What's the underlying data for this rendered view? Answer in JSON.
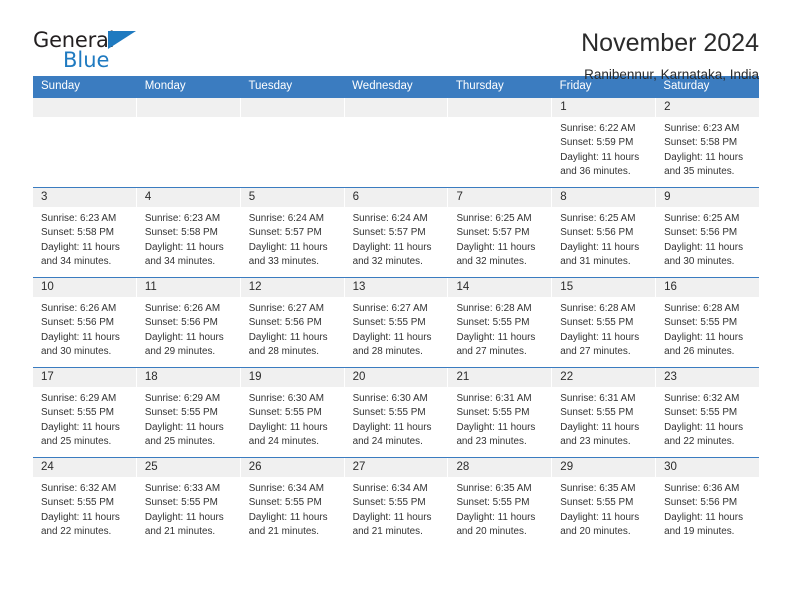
{
  "brand": {
    "name_part1": "General",
    "name_part2": "Blue",
    "triangle_color": "#1f7ac0"
  },
  "header": {
    "title": "November 2024",
    "subtitle": "Ranibennur, Karnataka, India"
  },
  "calendar": {
    "accent_color": "#3b7cc0",
    "daynum_bg": "#f0f0f0",
    "weekday_headers": [
      "Sunday",
      "Monday",
      "Tuesday",
      "Wednesday",
      "Thursday",
      "Friday",
      "Saturday"
    ],
    "weeks": [
      [
        {
          "day": "",
          "empty": true
        },
        {
          "day": "",
          "empty": true
        },
        {
          "day": "",
          "empty": true
        },
        {
          "day": "",
          "empty": true
        },
        {
          "day": "",
          "empty": true
        },
        {
          "day": "1",
          "sunrise": "Sunrise: 6:22 AM",
          "sunset": "Sunset: 5:59 PM",
          "daylight": "Daylight: 11 hours and 36 minutes."
        },
        {
          "day": "2",
          "sunrise": "Sunrise: 6:23 AM",
          "sunset": "Sunset: 5:58 PM",
          "daylight": "Daylight: 11 hours and 35 minutes."
        }
      ],
      [
        {
          "day": "3",
          "sunrise": "Sunrise: 6:23 AM",
          "sunset": "Sunset: 5:58 PM",
          "daylight": "Daylight: 11 hours and 34 minutes."
        },
        {
          "day": "4",
          "sunrise": "Sunrise: 6:23 AM",
          "sunset": "Sunset: 5:58 PM",
          "daylight": "Daylight: 11 hours and 34 minutes."
        },
        {
          "day": "5",
          "sunrise": "Sunrise: 6:24 AM",
          "sunset": "Sunset: 5:57 PM",
          "daylight": "Daylight: 11 hours and 33 minutes."
        },
        {
          "day": "6",
          "sunrise": "Sunrise: 6:24 AM",
          "sunset": "Sunset: 5:57 PM",
          "daylight": "Daylight: 11 hours and 32 minutes."
        },
        {
          "day": "7",
          "sunrise": "Sunrise: 6:25 AM",
          "sunset": "Sunset: 5:57 PM",
          "daylight": "Daylight: 11 hours and 32 minutes."
        },
        {
          "day": "8",
          "sunrise": "Sunrise: 6:25 AM",
          "sunset": "Sunset: 5:56 PM",
          "daylight": "Daylight: 11 hours and 31 minutes."
        },
        {
          "day": "9",
          "sunrise": "Sunrise: 6:25 AM",
          "sunset": "Sunset: 5:56 PM",
          "daylight": "Daylight: 11 hours and 30 minutes."
        }
      ],
      [
        {
          "day": "10",
          "sunrise": "Sunrise: 6:26 AM",
          "sunset": "Sunset: 5:56 PM",
          "daylight": "Daylight: 11 hours and 30 minutes."
        },
        {
          "day": "11",
          "sunrise": "Sunrise: 6:26 AM",
          "sunset": "Sunset: 5:56 PM",
          "daylight": "Daylight: 11 hours and 29 minutes."
        },
        {
          "day": "12",
          "sunrise": "Sunrise: 6:27 AM",
          "sunset": "Sunset: 5:56 PM",
          "daylight": "Daylight: 11 hours and 28 minutes."
        },
        {
          "day": "13",
          "sunrise": "Sunrise: 6:27 AM",
          "sunset": "Sunset: 5:55 PM",
          "daylight": "Daylight: 11 hours and 28 minutes."
        },
        {
          "day": "14",
          "sunrise": "Sunrise: 6:28 AM",
          "sunset": "Sunset: 5:55 PM",
          "daylight": "Daylight: 11 hours and 27 minutes."
        },
        {
          "day": "15",
          "sunrise": "Sunrise: 6:28 AM",
          "sunset": "Sunset: 5:55 PM",
          "daylight": "Daylight: 11 hours and 27 minutes."
        },
        {
          "day": "16",
          "sunrise": "Sunrise: 6:28 AM",
          "sunset": "Sunset: 5:55 PM",
          "daylight": "Daylight: 11 hours and 26 minutes."
        }
      ],
      [
        {
          "day": "17",
          "sunrise": "Sunrise: 6:29 AM",
          "sunset": "Sunset: 5:55 PM",
          "daylight": "Daylight: 11 hours and 25 minutes."
        },
        {
          "day": "18",
          "sunrise": "Sunrise: 6:29 AM",
          "sunset": "Sunset: 5:55 PM",
          "daylight": "Daylight: 11 hours and 25 minutes."
        },
        {
          "day": "19",
          "sunrise": "Sunrise: 6:30 AM",
          "sunset": "Sunset: 5:55 PM",
          "daylight": "Daylight: 11 hours and 24 minutes."
        },
        {
          "day": "20",
          "sunrise": "Sunrise: 6:30 AM",
          "sunset": "Sunset: 5:55 PM",
          "daylight": "Daylight: 11 hours and 24 minutes."
        },
        {
          "day": "21",
          "sunrise": "Sunrise: 6:31 AM",
          "sunset": "Sunset: 5:55 PM",
          "daylight": "Daylight: 11 hours and 23 minutes."
        },
        {
          "day": "22",
          "sunrise": "Sunrise: 6:31 AM",
          "sunset": "Sunset: 5:55 PM",
          "daylight": "Daylight: 11 hours and 23 minutes."
        },
        {
          "day": "23",
          "sunrise": "Sunrise: 6:32 AM",
          "sunset": "Sunset: 5:55 PM",
          "daylight": "Daylight: 11 hours and 22 minutes."
        }
      ],
      [
        {
          "day": "24",
          "sunrise": "Sunrise: 6:32 AM",
          "sunset": "Sunset: 5:55 PM",
          "daylight": "Daylight: 11 hours and 22 minutes."
        },
        {
          "day": "25",
          "sunrise": "Sunrise: 6:33 AM",
          "sunset": "Sunset: 5:55 PM",
          "daylight": "Daylight: 11 hours and 21 minutes."
        },
        {
          "day": "26",
          "sunrise": "Sunrise: 6:34 AM",
          "sunset": "Sunset: 5:55 PM",
          "daylight": "Daylight: 11 hours and 21 minutes."
        },
        {
          "day": "27",
          "sunrise": "Sunrise: 6:34 AM",
          "sunset": "Sunset: 5:55 PM",
          "daylight": "Daylight: 11 hours and 21 minutes."
        },
        {
          "day": "28",
          "sunrise": "Sunrise: 6:35 AM",
          "sunset": "Sunset: 5:55 PM",
          "daylight": "Daylight: 11 hours and 20 minutes."
        },
        {
          "day": "29",
          "sunrise": "Sunrise: 6:35 AM",
          "sunset": "Sunset: 5:55 PM",
          "daylight": "Daylight: 11 hours and 20 minutes."
        },
        {
          "day": "30",
          "sunrise": "Sunrise: 6:36 AM",
          "sunset": "Sunset: 5:56 PM",
          "daylight": "Daylight: 11 hours and 19 minutes."
        }
      ]
    ]
  }
}
